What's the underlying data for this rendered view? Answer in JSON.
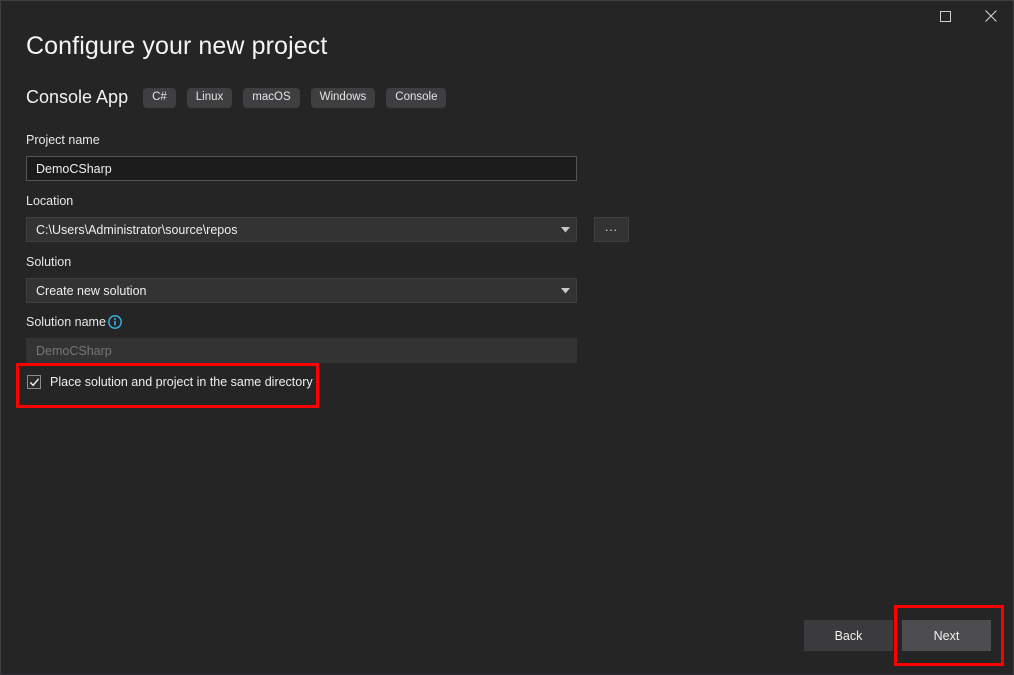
{
  "window": {
    "maximize_tooltip": "Maximize",
    "close_tooltip": "Close"
  },
  "header": {
    "title": "Configure your new project",
    "template_name": "Console App",
    "tags": [
      "C#",
      "Linux",
      "macOS",
      "Windows",
      "Console"
    ]
  },
  "form": {
    "project_name": {
      "label": "Project name",
      "value": "DemoCSharp"
    },
    "location": {
      "label": "Location",
      "value": "C:\\Users\\Administrator\\source\\repos",
      "browse_label": "..."
    },
    "solution": {
      "label": "Solution",
      "value": "Create new solution"
    },
    "solution_name": {
      "label": "Solution name",
      "value": "DemoCSharp",
      "info_icon": "info-icon"
    },
    "same_directory": {
      "label": "Place solution and project in the same directory",
      "checked": "✓"
    }
  },
  "footer": {
    "back_label": "Back",
    "next_label": "Next"
  },
  "colors": {
    "background": "#252526",
    "annotation": "#fe0000",
    "info": "#35b9ea",
    "input_bg": "#1b1b1c",
    "combo_bg": "#333334"
  }
}
